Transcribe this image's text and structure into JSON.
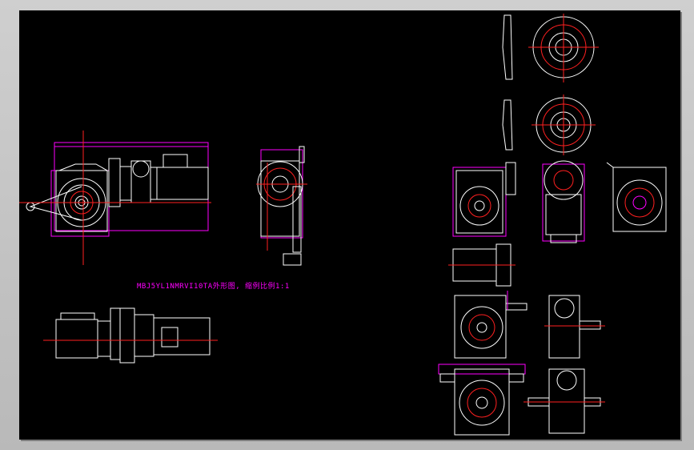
{
  "drawing": {
    "title_note": "MBJ5YL1NMRVI10TA外形图, 缩例比例1:1",
    "colors": {
      "background": "#000000",
      "frame": "#bdbdbd",
      "outline": "#ffffff",
      "centerline": "#ff2020",
      "dimension": "#ff00ff",
      "hidden": "#00a0ff"
    }
  }
}
